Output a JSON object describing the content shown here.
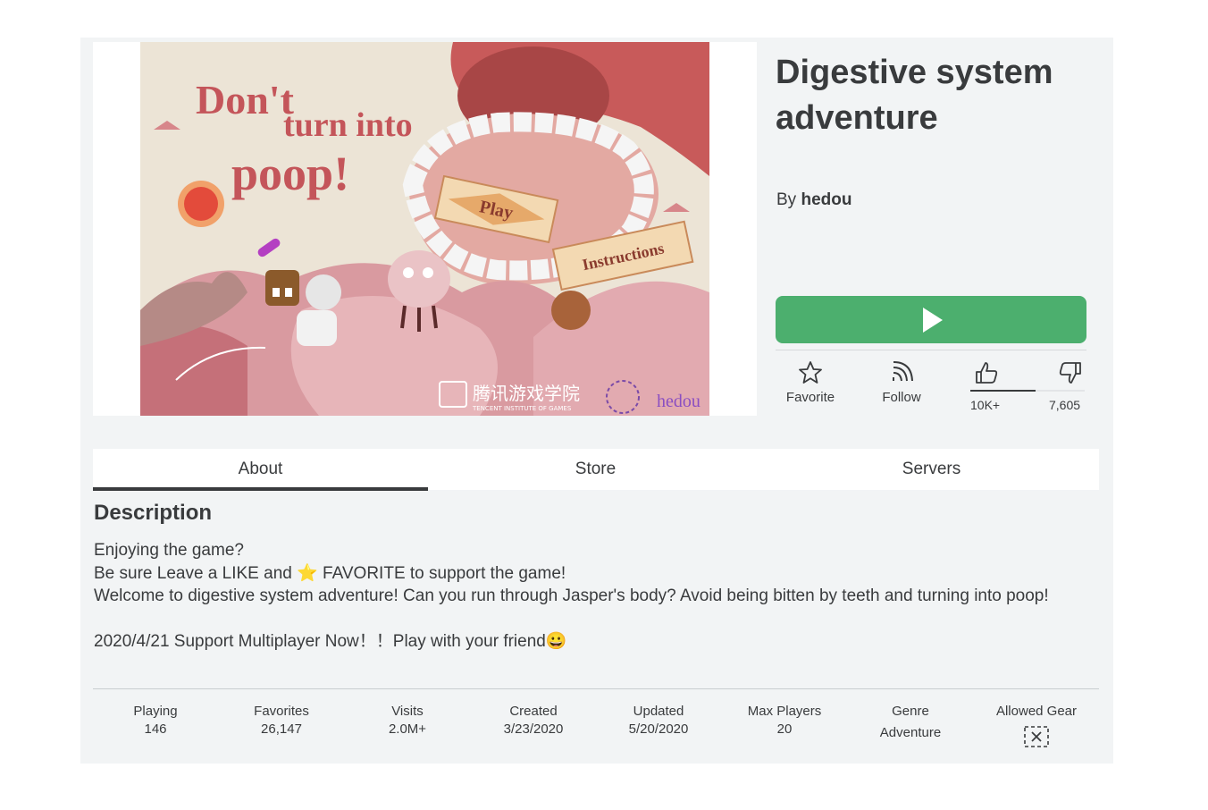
{
  "game": {
    "title": "Digestive system adventure",
    "by_prefix": "By",
    "creator": "hedou"
  },
  "thumbnail": {
    "headline_1": "Don't",
    "headline_2": "turn into",
    "headline_3": "poop!",
    "play_sign": "Play",
    "instructions_sign": "Instructions",
    "sponsor_cn": "腾讯游戏学院",
    "sponsor_en": "TENCENT INSTITUTE OF GAMES",
    "signature": "hedou"
  },
  "actions": {
    "favorite": "Favorite",
    "follow": "Follow",
    "likes": "10K+",
    "dislikes": "7,605",
    "like_ratio": 0.57
  },
  "tabs": [
    {
      "label": "About"
    },
    {
      "label": "Store"
    },
    {
      "label": "Servers"
    }
  ],
  "description": {
    "heading": "Description",
    "line1": "Enjoying the game?",
    "line2_a": "Be sure  Leave a LIKE and ",
    "line2_b": " FAVORITE to support the game!",
    "line3": "Welcome to digestive system adventure! Can you run through Jasper's body?  Avoid being bitten by teeth and turning into poop!",
    "line4": "2020/4/21 Support Multiplayer Now！！Play with your friend"
  },
  "stats": {
    "playing": {
      "label": "Playing",
      "value": "146"
    },
    "favorites": {
      "label": "Favorites",
      "value": "26,147"
    },
    "visits": {
      "label": "Visits",
      "value": "2.0M+"
    },
    "created": {
      "label": "Created",
      "value": "3/23/2020"
    },
    "updated": {
      "label": "Updated",
      "value": "5/20/2020"
    },
    "max_players": {
      "label": "Max Players",
      "value": "20"
    },
    "genre": {
      "label": "Genre",
      "value": "Adventure"
    },
    "allowed_gear": {
      "label": "Allowed Gear"
    }
  },
  "colors": {
    "play_button": "#4caf6e",
    "text": "#393b3d",
    "panel": "#f2f4f5"
  }
}
